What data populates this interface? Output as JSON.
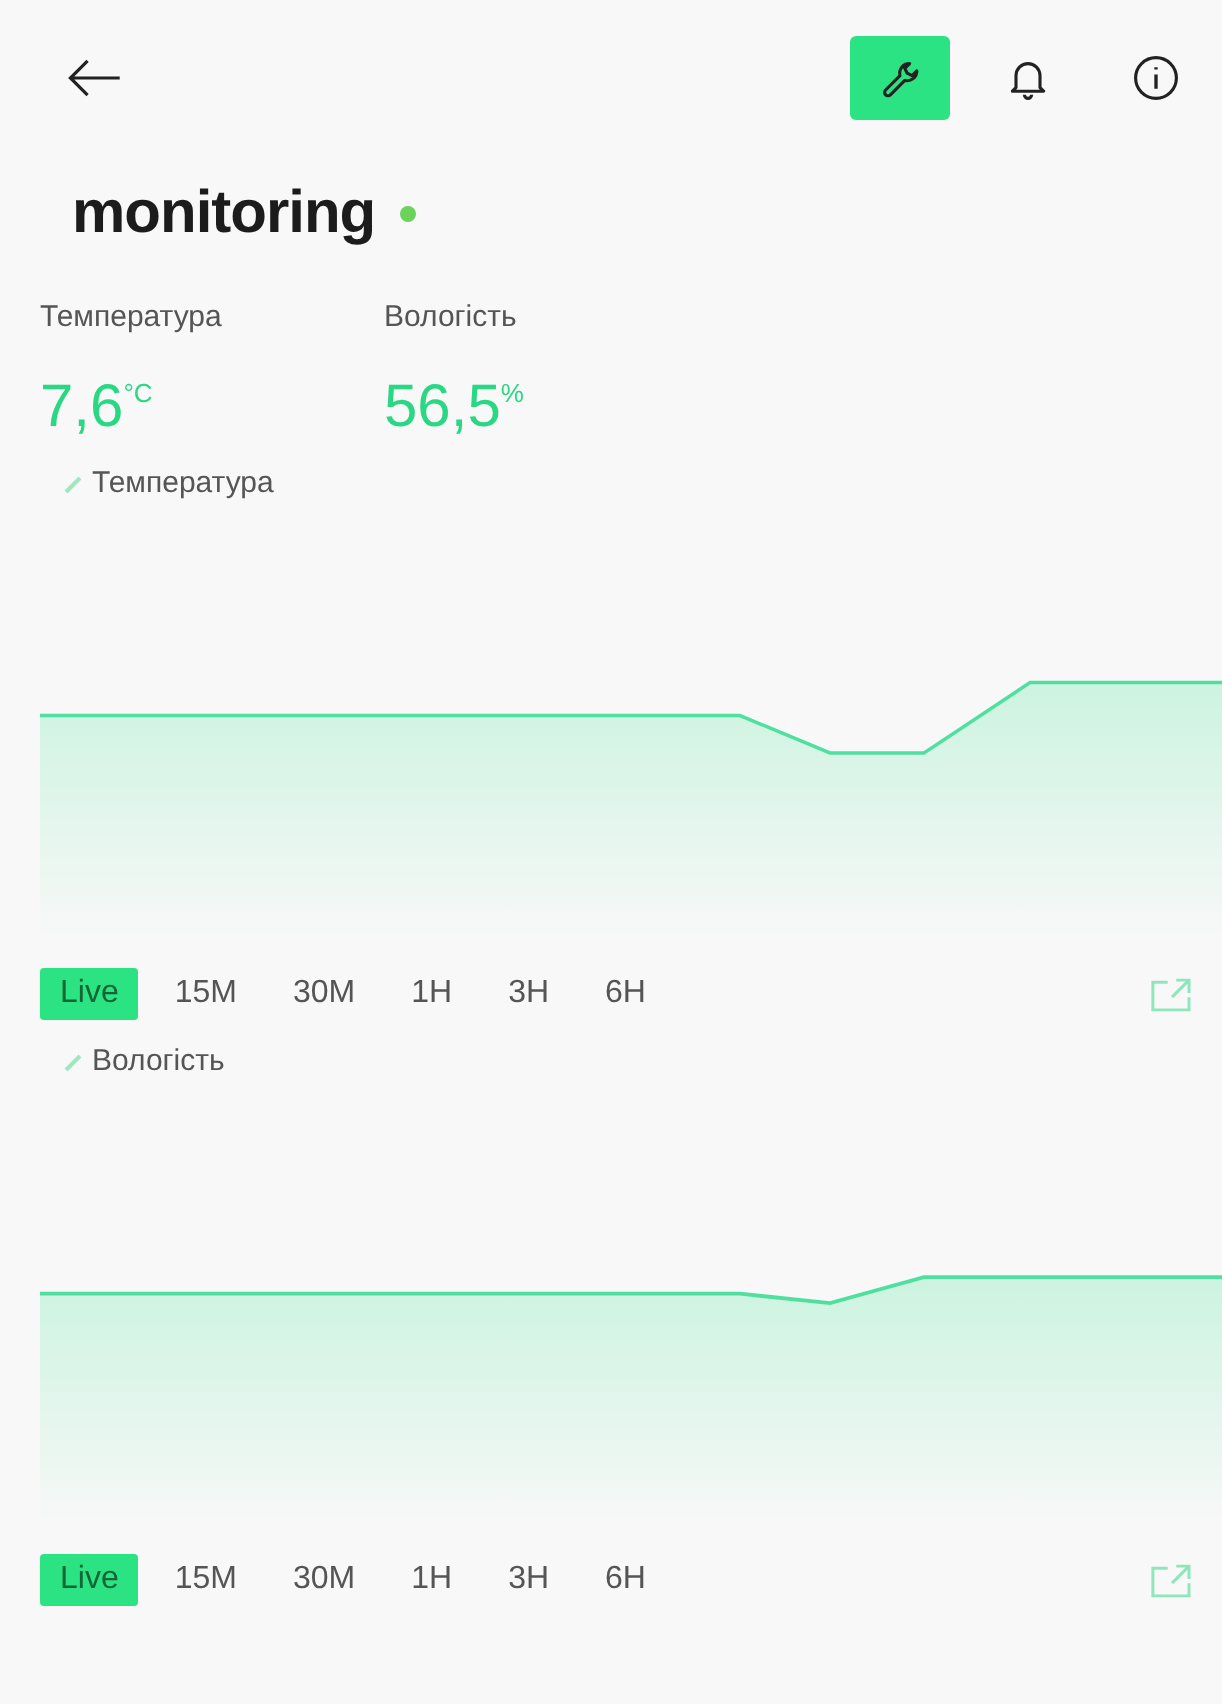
{
  "header": {
    "tools": [
      {
        "kind": "wrench",
        "selected": true
      },
      {
        "kind": "bell",
        "selected": false
      },
      {
        "kind": "info",
        "selected": false
      }
    ]
  },
  "device": {
    "title": "monitoring",
    "online": true
  },
  "readings": [
    {
      "label": "Температура",
      "value": "7,6",
      "unit": "°C"
    },
    {
      "label": "Вологість",
      "value": "56,5",
      "unit": "%"
    }
  ],
  "charts": [
    {
      "label": "Температура",
      "ranges": [
        {
          "label": "Live",
          "selected": true
        },
        {
          "label": "15M",
          "selected": false
        },
        {
          "label": "30M",
          "selected": false
        },
        {
          "label": "1H",
          "selected": false
        },
        {
          "label": "3H",
          "selected": false
        },
        {
          "label": "6H",
          "selected": false
        }
      ]
    },
    {
      "label": "Вологість",
      "ranges": [
        {
          "label": "Live",
          "selected": true
        },
        {
          "label": "15M",
          "selected": false
        },
        {
          "label": "30M",
          "selected": false
        },
        {
          "label": "1H",
          "selected": false
        },
        {
          "label": "3H",
          "selected": false
        },
        {
          "label": "6H",
          "selected": false
        }
      ]
    }
  ]
}
